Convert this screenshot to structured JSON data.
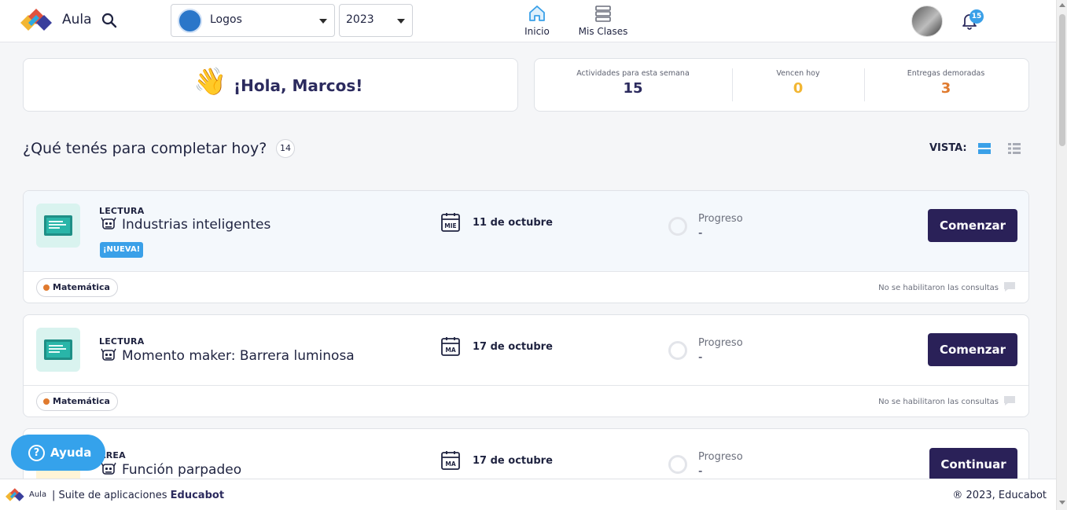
{
  "header": {
    "app_name": "Aula",
    "school_select": "Logos",
    "year_select": "2023",
    "nav": [
      {
        "label": "Inicio"
      },
      {
        "label": "Mis Clases"
      }
    ],
    "notification_count": "15",
    "accent_color": "#3aa0e8"
  },
  "greeting": {
    "emoji": "👋",
    "text": "¡Hola, Marcos!"
  },
  "stats": [
    {
      "label": "Actividades para esta semana",
      "value": "15",
      "color": "#2c2b5e"
    },
    {
      "label": "Vencen hoy",
      "value": "0",
      "color": "#f2b633"
    },
    {
      "label": "Entregas demoradas",
      "value": "3",
      "color": "#e07a2e"
    }
  ],
  "section": {
    "title": "¿Qué tenés para completar hoy?",
    "count": "14",
    "vista_label": "VISTA:"
  },
  "activities": [
    {
      "type": "LECTURA",
      "title": "Industrias inteligentes",
      "badge": "¡NUEVA!",
      "day_abbr": "MIE",
      "date": "11 de octubre",
      "progress_label": "Progreso",
      "progress_value": "-",
      "action": "Comenzar",
      "subject": "Matemática",
      "consult": "No se habilitaron las consultas"
    },
    {
      "type": "LECTURA",
      "title": "Momento maker: Barrera luminosa",
      "day_abbr": "MA",
      "date": "17 de octubre",
      "progress_label": "Progreso",
      "progress_value": "-",
      "action": "Comenzar",
      "subject": "Matemática",
      "consult": "No se habilitaron las consultas"
    },
    {
      "type": "AREA",
      "title": "Función parpadeo",
      "day_abbr": "MA",
      "date": "17 de octubre",
      "progress_label": "Progreso",
      "progress_value": "-",
      "action": "Continuar"
    }
  ],
  "help": {
    "label": "Ayuda",
    "icon": "?"
  },
  "footer": {
    "brand": "Aula",
    "suite_prefix": "| Suite de aplicaciones",
    "suite_brand": "Educabot",
    "copyright": "® 2023, Educabot"
  }
}
